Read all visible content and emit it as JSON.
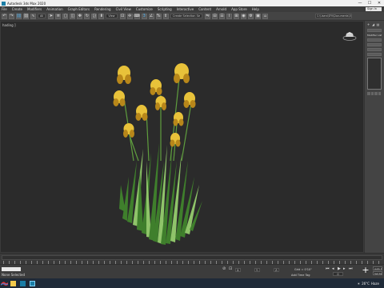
{
  "window": {
    "title": "Autodesk 3ds Max 2020",
    "min": "—",
    "max": "☐",
    "close": "✕"
  },
  "menu": {
    "items": [
      "File",
      "Create",
      "Modifiers",
      "Animation",
      "Graph Editors",
      "Rendering",
      "Civil View",
      "Customize",
      "Scripting",
      "Interactive",
      "Content",
      "Arnold",
      "App Store",
      "Help"
    ],
    "signin": "Sign In"
  },
  "toolbar": {
    "undo_icon": "↶",
    "redo_icon": "↷",
    "select_filter": "All",
    "view_mode": "View",
    "selection_set": "Create Selection Se",
    "path": "C:\\Users\\SFK\\Documents\\3ds Max 2020"
  },
  "viewport": {
    "label": "[+] [Perspective] [Standard] [Default Shading]",
    "label_visible": "hading ]"
  },
  "command_panel": {
    "tabs": [
      "+",
      "◢",
      "▤"
    ],
    "modifier_list": "Modifier List"
  },
  "status": {
    "maxscript": "",
    "selection": "None Selected",
    "coordinates": {
      "x": "X:",
      "y": "Y:",
      "z": "Z:"
    },
    "grid": "Grid = 0'10\"",
    "add_time_tag": "Add Time Tag",
    "frame": "0",
    "auto_key": "Auto Key",
    "set_key": "Set Key"
  },
  "taskbar": {
    "weather": "26°C",
    "condition": "Haze"
  },
  "colors": {
    "petal": "#e8c23a",
    "petal_dark": "#b8871a",
    "stem": "#5f9e3e",
    "leaf": "#3f7f2c",
    "leaf_light": "#8fc46a",
    "accent_blue": "#4fb3f2"
  }
}
